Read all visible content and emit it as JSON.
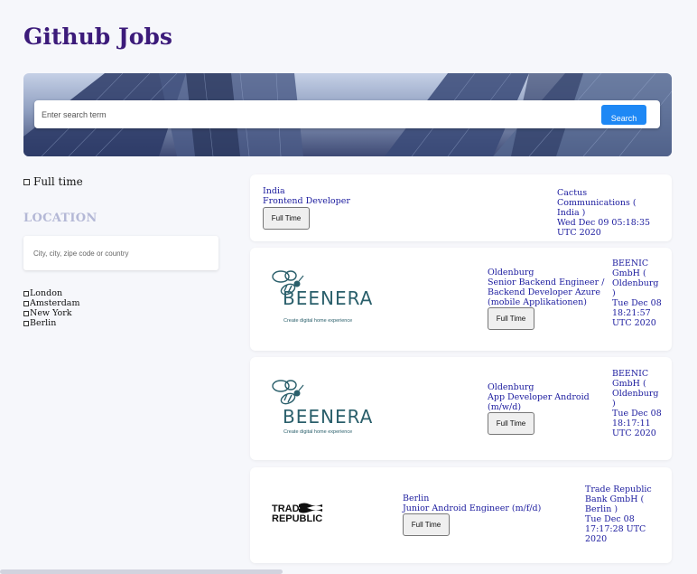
{
  "header": {
    "title": "Github Jobs"
  },
  "search": {
    "placeholder": "Enter search term",
    "button_label": "Search"
  },
  "filters": {
    "full_time_label": "Full time",
    "location_title": "LOCATION",
    "location_placeholder": "City, city, zipe code or country",
    "cities": [
      "London",
      "Amsterdam",
      "New York",
      "Berlin"
    ]
  },
  "jobs": [
    {
      "location": "India",
      "title": "Frontend Developer",
      "type_label": "Full Time",
      "company": "Cactus Communications ( India )",
      "date": "Wed Dec 09 05:18:35 UTC 2020",
      "logo": "none"
    },
    {
      "location": "Oldenburg",
      "title": "Senior Backend Engineer / Backend Developer Azure (mobile Applikationen) (m/w/d)",
      "type_label": "Full Time",
      "company": "BEENIC GmbH ( Oldenburg )",
      "date": "Tue Dec 08 18:21:57 UTC 2020",
      "logo": "beenera",
      "logo_text": "BEENERA",
      "logo_tagline": "Create digital home experience"
    },
    {
      "location": "Oldenburg",
      "title": "App Developer Android (m/w/d)",
      "type_label": "Full Time",
      "company": "BEENIC GmbH ( Oldenburg )",
      "date": "Tue Dec 08 18:17:11 UTC 2020",
      "logo": "beenera",
      "logo_text": "BEENERA",
      "logo_tagline": "Create digital home experience"
    },
    {
      "location": "Berlin",
      "title": "Junior Android Engineer (m/f/d)",
      "type_label": "Full Time",
      "company": "Trade Republic Bank GmbH ( Berlin )",
      "date": "Tue Dec 08 17:17:28 UTC 2020",
      "logo": "trade-republic",
      "logo_text_line1": "TRADE",
      "logo_text_line2": "REPUBLIC"
    }
  ],
  "colors": {
    "title": "#3c1b7a",
    "link_text": "#1b1b9e",
    "search_button": "#1e88f5",
    "location_title": "#b4b8d6",
    "page_bg": "#f6f7fb",
    "beenera_teal": "#2a5f6b"
  }
}
